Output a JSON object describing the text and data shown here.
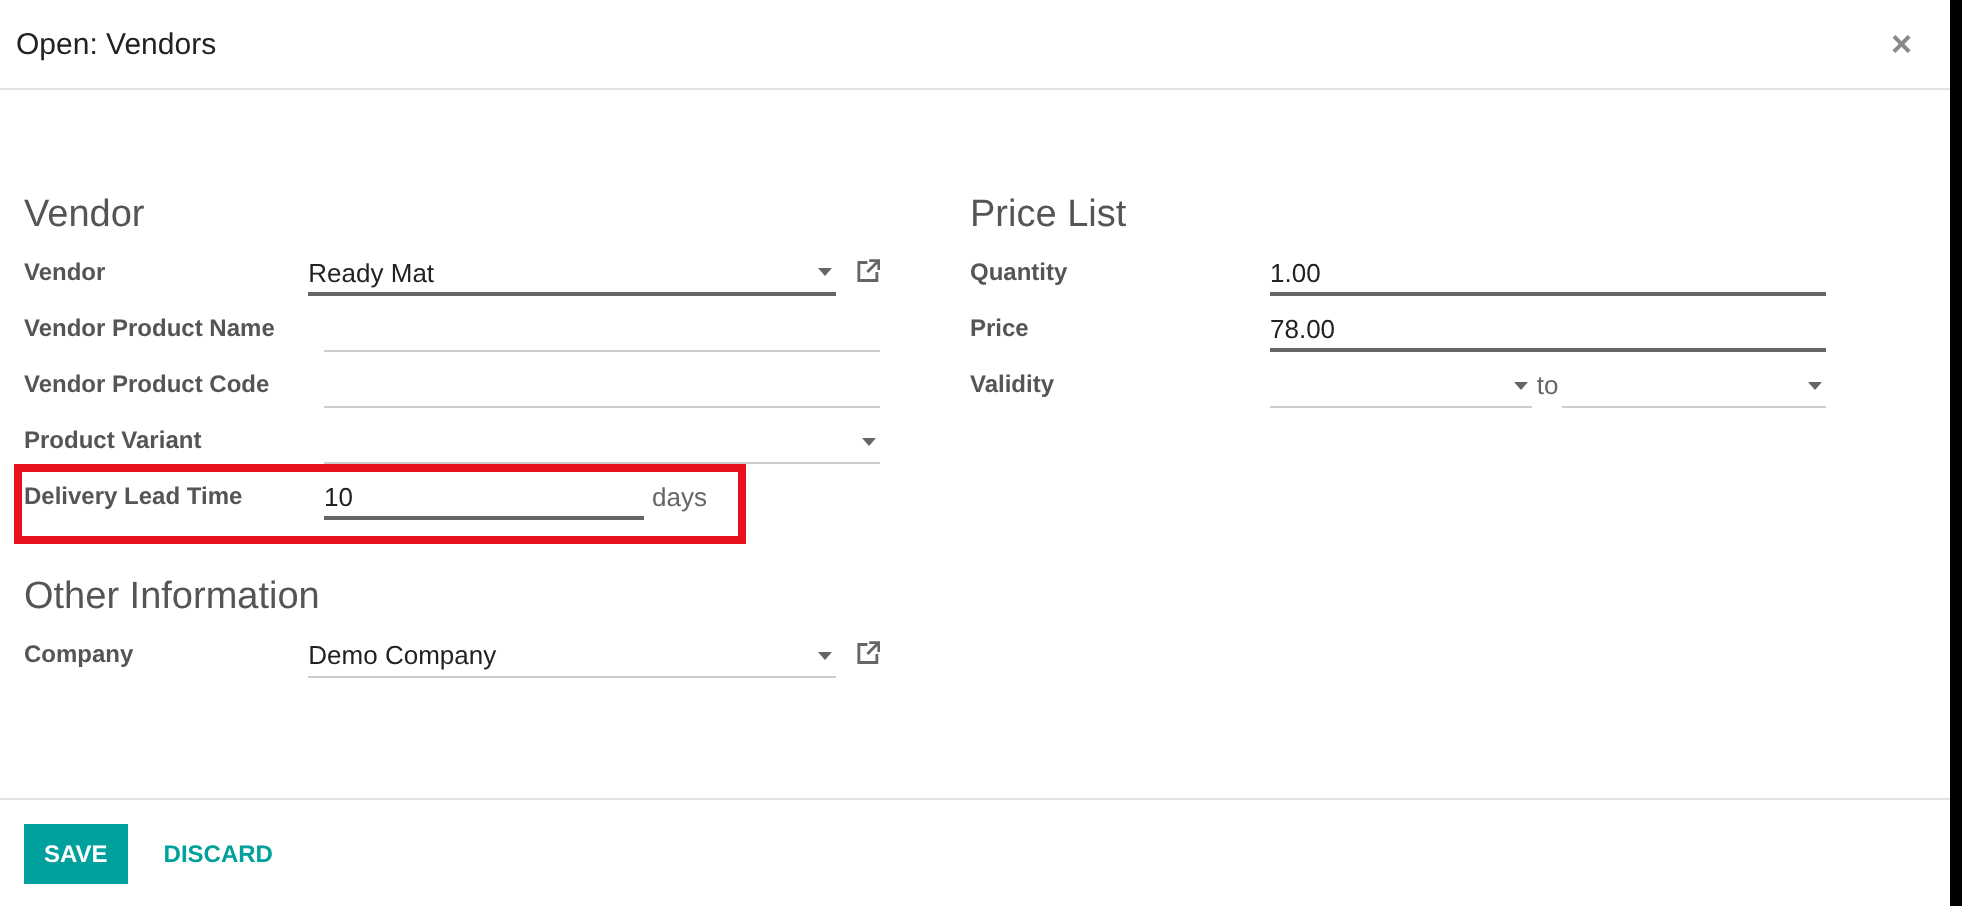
{
  "dialog": {
    "title": "Open: Vendors",
    "close": "×"
  },
  "groups": [
    {
      "title": "Vendor",
      "fields": [
        {
          "label": "Vendor",
          "kind": "select",
          "value": "Ready Mat",
          "required": true,
          "link": true
        },
        {
          "label": "Vendor Product Name",
          "kind": "text",
          "required": false
        },
        {
          "label": "Vendor Product Code",
          "kind": "text",
          "required": false
        },
        {
          "label": "Product Variant",
          "kind": "select",
          "required": false
        },
        {
          "label": "Delivery Lead Time",
          "kind": "unit",
          "value": "10",
          "unit": "days",
          "required": true,
          "highlighted": true
        }
      ]
    },
    {
      "title": "Other Information",
      "fields": [
        {
          "label": "Company",
          "kind": "select",
          "value": "Demo Company",
          "required": false,
          "link": true
        }
      ]
    }
  ],
  "side_groups": [
    {
      "title": "Price List",
      "fields": [
        {
          "label": "Quantity",
          "kind": "text",
          "value": "1.00",
          "required": true
        },
        {
          "label": "Price",
          "kind": "text",
          "value": "78.00",
          "required": true
        },
        {
          "label": "Validity",
          "kind": "range",
          "separator": "to",
          "required": false
        }
      ]
    }
  ],
  "buttons": [
    {
      "label": "SAVE",
      "kind": "primary"
    },
    {
      "label": "DISCARD",
      "kind": "link"
    }
  ]
}
